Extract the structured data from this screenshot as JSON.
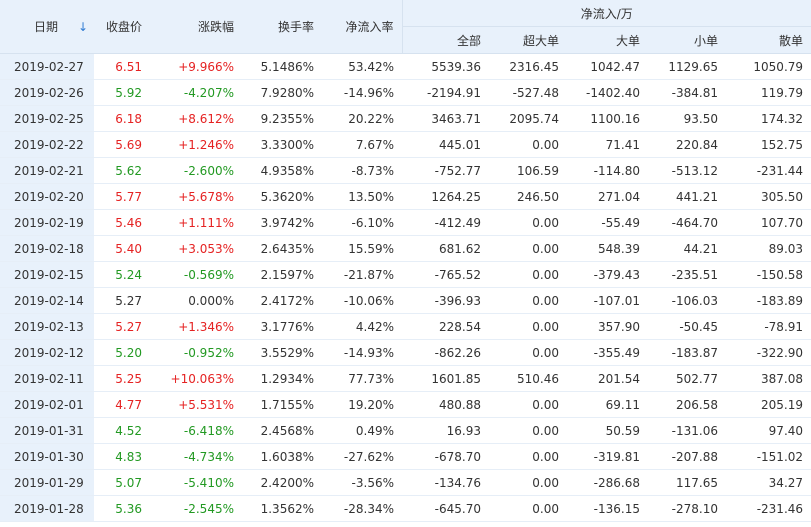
{
  "headers": {
    "date": "日期",
    "sort_arrow": "↓",
    "close": "收盘价",
    "change": "涨跌幅",
    "turnover": "换手率",
    "netflow_rate": "净流入率",
    "netflow_group": "净流入/万",
    "total": "全部",
    "super": "超大单",
    "large": "大单",
    "small": "小单",
    "retail": "散单"
  },
  "colors": {
    "up": "#e52222",
    "down": "#229922",
    "header_bg": "#e8f1fb",
    "arrow": "#2f7bd3"
  },
  "rows": [
    {
      "date": "2019-02-27",
      "close": "6.51",
      "change": "+9.966%",
      "turnover": "5.1486%",
      "rate": "53.42%",
      "total": "5539.36",
      "super": "2316.45",
      "large": "1042.47",
      "small": "1129.65",
      "retail": "1050.79",
      "trend": "up"
    },
    {
      "date": "2019-02-26",
      "close": "5.92",
      "change": "-4.207%",
      "turnover": "7.9280%",
      "rate": "-14.96%",
      "total": "-2194.91",
      "super": "-527.48",
      "large": "-1402.40",
      "small": "-384.81",
      "retail": "119.79",
      "trend": "down"
    },
    {
      "date": "2019-02-25",
      "close": "6.18",
      "change": "+8.612%",
      "turnover": "9.2355%",
      "rate": "20.22%",
      "total": "3463.71",
      "super": "2095.74",
      "large": "1100.16",
      "small": "93.50",
      "retail": "174.32",
      "trend": "up"
    },
    {
      "date": "2019-02-22",
      "close": "5.69",
      "change": "+1.246%",
      "turnover": "3.3300%",
      "rate": "7.67%",
      "total": "445.01",
      "super": "0.00",
      "large": "71.41",
      "small": "220.84",
      "retail": "152.75",
      "trend": "up"
    },
    {
      "date": "2019-02-21",
      "close": "5.62",
      "change": "-2.600%",
      "turnover": "4.9358%",
      "rate": "-8.73%",
      "total": "-752.77",
      "super": "106.59",
      "large": "-114.80",
      "small": "-513.12",
      "retail": "-231.44",
      "trend": "down"
    },
    {
      "date": "2019-02-20",
      "close": "5.77",
      "change": "+5.678%",
      "turnover": "5.3620%",
      "rate": "13.50%",
      "total": "1264.25",
      "super": "246.50",
      "large": "271.04",
      "small": "441.21",
      "retail": "305.50",
      "trend": "up"
    },
    {
      "date": "2019-02-19",
      "close": "5.46",
      "change": "+1.111%",
      "turnover": "3.9742%",
      "rate": "-6.10%",
      "total": "-412.49",
      "super": "0.00",
      "large": "-55.49",
      "small": "-464.70",
      "retail": "107.70",
      "trend": "up"
    },
    {
      "date": "2019-02-18",
      "close": "5.40",
      "change": "+3.053%",
      "turnover": "2.6435%",
      "rate": "15.59%",
      "total": "681.62",
      "super": "0.00",
      "large": "548.39",
      "small": "44.21",
      "retail": "89.03",
      "trend": "up"
    },
    {
      "date": "2019-02-15",
      "close": "5.24",
      "change": "-0.569%",
      "turnover": "2.1597%",
      "rate": "-21.87%",
      "total": "-765.52",
      "super": "0.00",
      "large": "-379.43",
      "small": "-235.51",
      "retail": "-150.58",
      "trend": "down"
    },
    {
      "date": "2019-02-14",
      "close": "5.27",
      "change": "0.000%",
      "turnover": "2.4172%",
      "rate": "-10.06%",
      "total": "-396.93",
      "super": "0.00",
      "large": "-107.01",
      "small": "-106.03",
      "retail": "-183.89",
      "trend": "flat"
    },
    {
      "date": "2019-02-13",
      "close": "5.27",
      "change": "+1.346%",
      "turnover": "3.1776%",
      "rate": "4.42%",
      "total": "228.54",
      "super": "0.00",
      "large": "357.90",
      "small": "-50.45",
      "retail": "-78.91",
      "trend": "up"
    },
    {
      "date": "2019-02-12",
      "close": "5.20",
      "change": "-0.952%",
      "turnover": "3.5529%",
      "rate": "-14.93%",
      "total": "-862.26",
      "super": "0.00",
      "large": "-355.49",
      "small": "-183.87",
      "retail": "-322.90",
      "trend": "down"
    },
    {
      "date": "2019-02-11",
      "close": "5.25",
      "change": "+10.063%",
      "turnover": "1.2934%",
      "rate": "77.73%",
      "total": "1601.85",
      "super": "510.46",
      "large": "201.54",
      "small": "502.77",
      "retail": "387.08",
      "trend": "up"
    },
    {
      "date": "2019-02-01",
      "close": "4.77",
      "change": "+5.531%",
      "turnover": "1.7155%",
      "rate": "19.20%",
      "total": "480.88",
      "super": "0.00",
      "large": "69.11",
      "small": "206.58",
      "retail": "205.19",
      "trend": "up"
    },
    {
      "date": "2019-01-31",
      "close": "4.52",
      "change": "-6.418%",
      "turnover": "2.4568%",
      "rate": "0.49%",
      "total": "16.93",
      "super": "0.00",
      "large": "50.59",
      "small": "-131.06",
      "retail": "97.40",
      "trend": "down"
    },
    {
      "date": "2019-01-30",
      "close": "4.83",
      "change": "-4.734%",
      "turnover": "1.6038%",
      "rate": "-27.62%",
      "total": "-678.70",
      "super": "0.00",
      "large": "-319.81",
      "small": "-207.88",
      "retail": "-151.02",
      "trend": "down"
    },
    {
      "date": "2019-01-29",
      "close": "5.07",
      "change": "-5.410%",
      "turnover": "2.4200%",
      "rate": "-3.56%",
      "total": "-134.76",
      "super": "0.00",
      "large": "-286.68",
      "small": "117.65",
      "retail": "34.27",
      "trend": "down"
    },
    {
      "date": "2019-01-28",
      "close": "5.36",
      "change": "-2.545%",
      "turnover": "1.3562%",
      "rate": "-28.34%",
      "total": "-645.70",
      "super": "0.00",
      "large": "-136.15",
      "small": "-278.10",
      "retail": "-231.46",
      "trend": "down"
    }
  ]
}
